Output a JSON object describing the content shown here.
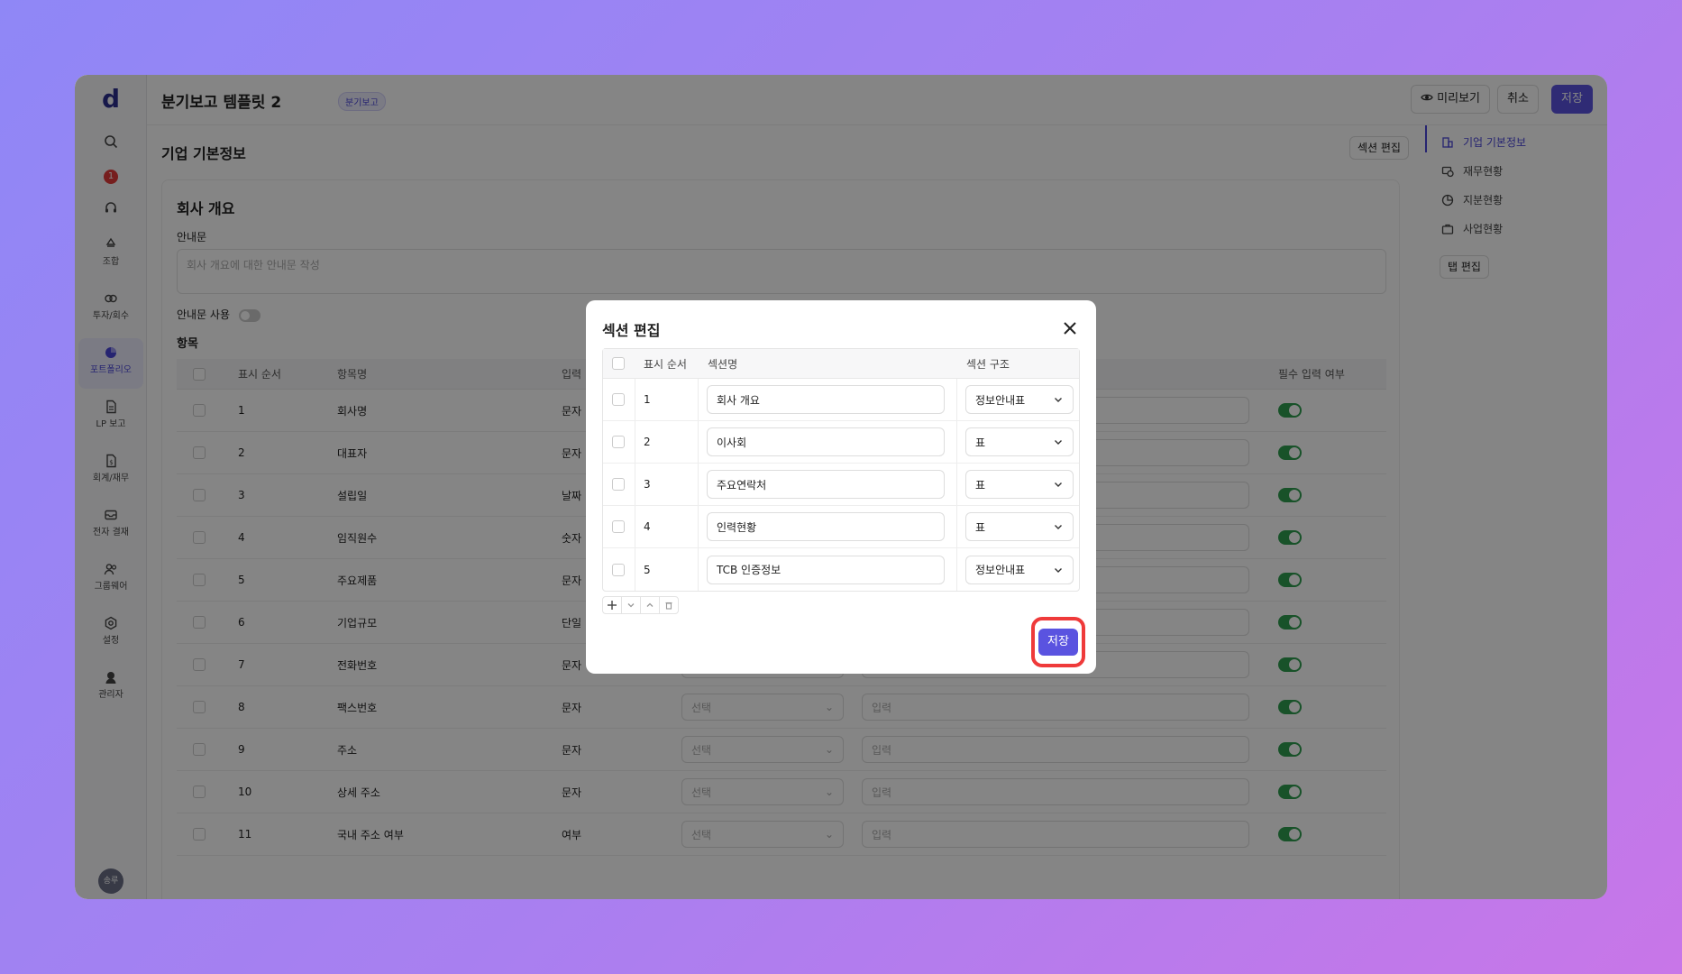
{
  "header": {
    "title": "분기보고 템플릿 2",
    "tag": "분기보고",
    "preview_label": "미리보기",
    "cancel_label": "취소",
    "save_label": "저장"
  },
  "sidebar": {
    "logo": "d",
    "notification_count": "1",
    "items": [
      {
        "label": "조합",
        "icon": "recycle-icon"
      },
      {
        "label": "투자/회수",
        "icon": "investment-icon"
      },
      {
        "label": "포트폴리오",
        "icon": "portfolio-icon"
      },
      {
        "label": "LP 보고",
        "icon": "document-icon"
      },
      {
        "label": "회계/재무",
        "icon": "accounting-icon"
      },
      {
        "label": "전자 결재",
        "icon": "mail-icon"
      },
      {
        "label": "그룹웨어",
        "icon": "groupware-icon"
      },
      {
        "label": "설정",
        "icon": "settings-icon"
      },
      {
        "label": "관리자",
        "icon": "admin-icon"
      }
    ],
    "avatar": "송루"
  },
  "main": {
    "section_title": "기업 기본정보",
    "section_edit_label": "섹션 편집",
    "card_title": "회사 개요",
    "intro_label": "안내문",
    "intro_placeholder": "회사 개요에 대한 안내문 작성",
    "intro_toggle_label": "안내문 사용",
    "items_label": "항목",
    "table_headers": {
      "order": "표시 순서",
      "name": "항목명",
      "input": "입력",
      "required": "필수 입력 여부"
    },
    "select_placeholder": "선택",
    "input_placeholder": "입력",
    "rows": [
      {
        "order": "1",
        "name": "회사명",
        "type": "문자"
      },
      {
        "order": "2",
        "name": "대표자",
        "type": "문자"
      },
      {
        "order": "3",
        "name": "설립일",
        "type": "날짜"
      },
      {
        "order": "4",
        "name": "임직원수",
        "type": "숫자"
      },
      {
        "order": "5",
        "name": "주요제품",
        "type": "문자"
      },
      {
        "order": "6",
        "name": "기업규모",
        "type": "단일"
      },
      {
        "order": "7",
        "name": "전화번호",
        "type": "문자"
      },
      {
        "order": "8",
        "name": "팩스번호",
        "type": "문자"
      },
      {
        "order": "9",
        "name": "주소",
        "type": "문자"
      },
      {
        "order": "10",
        "name": "상세 주소",
        "type": "문자"
      },
      {
        "order": "11",
        "name": "국내 주소 여부",
        "type": "여부"
      }
    ]
  },
  "rightnav": {
    "items": [
      {
        "label": "기업 기본정보",
        "icon": "building-icon"
      },
      {
        "label": "재무현황",
        "icon": "finance-icon"
      },
      {
        "label": "지분현황",
        "icon": "pie-icon"
      },
      {
        "label": "사업현황",
        "icon": "briefcase-icon"
      }
    ],
    "tab_edit_label": "탭 편집"
  },
  "modal": {
    "title": "섹션 편집",
    "headers": {
      "order": "표시 순서",
      "name": "섹션명",
      "structure": "섹션 구조"
    },
    "rows": [
      {
        "order": "1",
        "name": "회사 개요",
        "structure": "정보안내표"
      },
      {
        "order": "2",
        "name": "이사회",
        "structure": "표"
      },
      {
        "order": "3",
        "name": "주요연락처",
        "structure": "표"
      },
      {
        "order": "4",
        "name": "인력현황",
        "structure": "표"
      },
      {
        "order": "5",
        "name": "TCB 인증정보",
        "structure": "정보안내표"
      }
    ],
    "save_label": "저장"
  },
  "colors": {
    "accent": "#5a53e0",
    "highlight": "#ef3a3a",
    "toggle_on": "#2e9e4f"
  }
}
